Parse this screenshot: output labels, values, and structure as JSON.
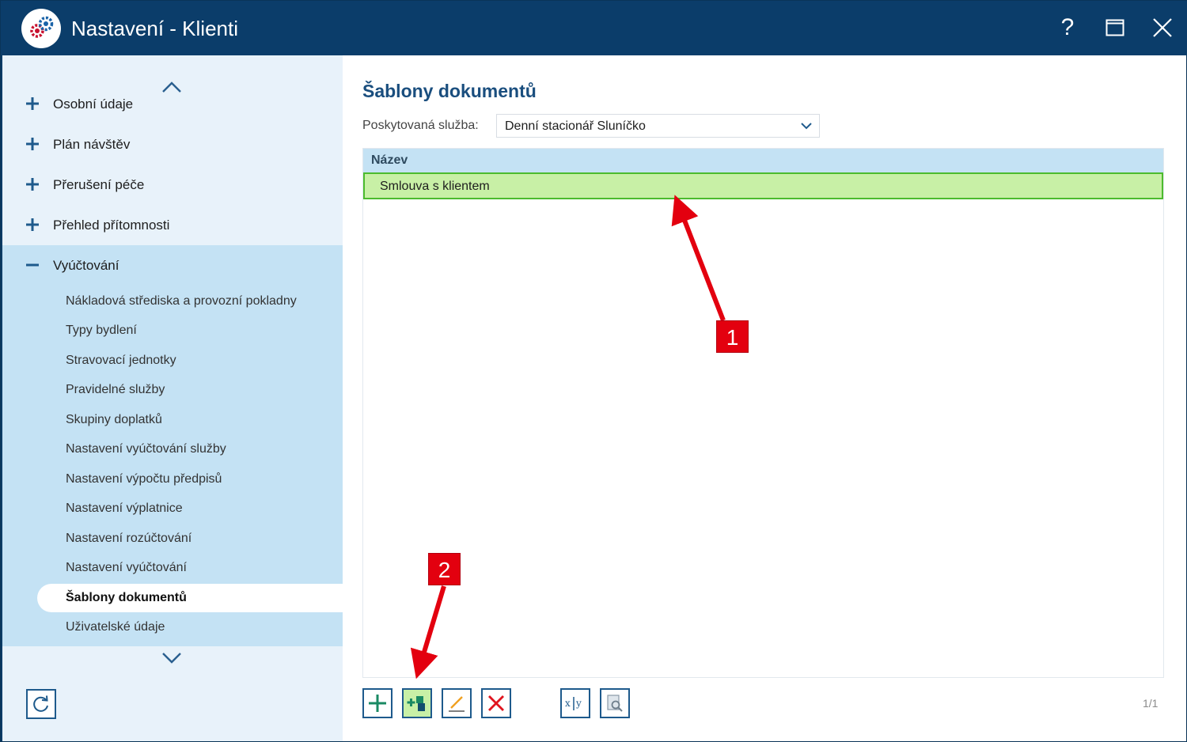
{
  "window": {
    "title": "Nastavení - Klienti",
    "help_label": "?"
  },
  "sidebar": {
    "groups": [
      {
        "label": "Osobní údaje"
      },
      {
        "label": "Plán návštěv"
      },
      {
        "label": "Přerušení péče"
      },
      {
        "label": "Přehled přítomnosti"
      }
    ],
    "expanded_group": {
      "label": "Vyúčtování",
      "items": [
        {
          "label": "Nákladová střediska a provozní pokladny"
        },
        {
          "label": "Typy bydlení"
        },
        {
          "label": "Stravovací jednotky"
        },
        {
          "label": "Pravidelné služby"
        },
        {
          "label": "Skupiny doplatků"
        },
        {
          "label": "Nastavení vyúčtování služby"
        },
        {
          "label": "Nastavení výpočtu předpisů"
        },
        {
          "label": "Nastavení výplatnice"
        },
        {
          "label": "Nastavení rozúčtování"
        },
        {
          "label": "Nastavení vyúčtování"
        },
        {
          "label": "Šablony dokumentů"
        },
        {
          "label": "Uživatelské údaje"
        }
      ],
      "active_item": "Šablony dokumentů"
    }
  },
  "main": {
    "title": "Šablony dokumentů",
    "filter": {
      "label": "Poskytovaná služba:",
      "value": "Denní stacionář Sluníčko"
    },
    "table": {
      "columns": [
        "Název"
      ],
      "rows": [
        [
          "Smlouva s klientem"
        ]
      ]
    },
    "pager": "1/1"
  },
  "annotations": {
    "callout_1": "1",
    "callout_2": "2",
    "color": "#e3000f"
  },
  "colors": {
    "titlebar": "#0b3d6a",
    "accent_blue": "#1a4e7e",
    "selected_row": "#c8f0a6",
    "selected_border": "#4cbb2e",
    "sidebar_expanded": "#c4e2f4"
  }
}
